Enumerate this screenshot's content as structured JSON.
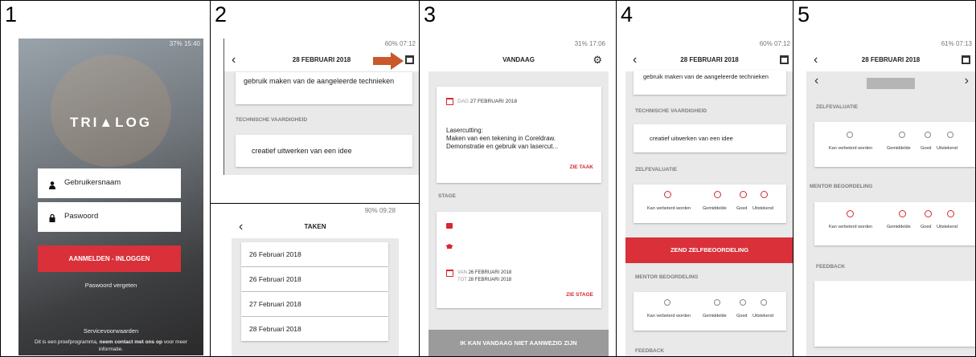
{
  "panels": [
    {
      "number": "1"
    },
    {
      "number": "2"
    },
    {
      "number": "3"
    },
    {
      "number": "4"
    },
    {
      "number": "5"
    }
  ],
  "screen1": {
    "status": "37% 15:40",
    "logo": "TRI▲LOG",
    "username_placeholder": "Gebruikersnaam",
    "password_placeholder": "Paswoord",
    "login_button": "AANMELDEN - INLOGGEN",
    "forgot": "Paswoord vergeten",
    "terms": "Servicevoorwaarden",
    "footer_pre": "Dit is een proefprogramma, ",
    "footer_bold": "neem contact met ons op",
    "footer_post": " voor meer informatie."
  },
  "screen2": {
    "status": "60% 07:12",
    "date": "28 FEBRUARI 2018",
    "card1_text": "gebruik maken van de aangeleerde technieken",
    "section": "TECHNISCHE VAARDIGHEID",
    "card2_text": "creatief uitwerken van een idee"
  },
  "screen2b": {
    "status": "90% 09:28",
    "title": "TAKEN",
    "items": [
      "26 Februari 2018",
      "26 Februari 2018",
      "27 Februari 2018",
      "28 Februari 2018"
    ]
  },
  "screen3": {
    "status": "31% 17:06",
    "title": "VANDAAG",
    "day_label": "DAG",
    "day_date": "27 FEBRUARI 2018",
    "task_title": "Lasercutting:",
    "task_line1": "Maken van een tekening in Coreldraw.",
    "task_line2": "Demonstratie en gebruik van lasercut...",
    "see_task": "ZIE TAAK",
    "stage_section": "STAGE",
    "from_label": "VAN",
    "from_date": "26 FEBRUARI 2018",
    "to_label": "TOT",
    "to_date": "28 FEBRUARI 2018",
    "see_stage": "ZIE STAGE",
    "absent_button": "IK KAN VANDAAG NIET AANWEZIG ZIJN"
  },
  "screen4": {
    "status": "60% 07:12",
    "date": "28 FEBRUARI 2018",
    "card1_text": "gebruik maken van de aangeleerde technieken",
    "tech_section": "TECHNISCHE VAARDIGHEID",
    "card2_text": "creatief uitwerken van een idee",
    "self_section": "ZELFEVALUATIE",
    "rating_labels": [
      "Kan verbeterd worden",
      "Gemiddelde",
      "Goed",
      "Uitstekend"
    ],
    "send_button": "ZEND ZELFBEOORDELING",
    "mentor_section": "MENTOR BEOORDELING",
    "feedback_section": "FEEDBACK"
  },
  "screen5": {
    "status": "61% 07:13",
    "date": "28 FEBRUARI 2018",
    "self_section": "ZELFEVALUATIE",
    "rating_labels": [
      "Kan verbeterd worden",
      "Gemiddelde",
      "Goed",
      "Uitstekend"
    ],
    "mentor_section": "MENTOR BEOORDELING",
    "feedback_section": "FEEDBACK"
  }
}
